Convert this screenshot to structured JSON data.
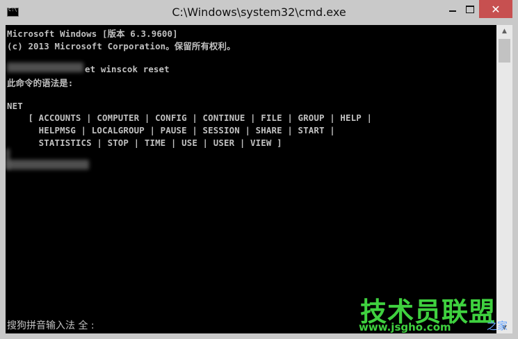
{
  "window": {
    "title": "C:\\Windows\\system32\\cmd.exe",
    "icon_text": "C:\\",
    "controls": {
      "minimize": "—",
      "maximize": "□",
      "close": "✕"
    }
  },
  "console": {
    "lines": [
      "Microsoft Windows [版本 6.3.9600]",
      "(c) 2013 Microsoft Corporation。保留所有权利。",
      "et winscok reset",
      "此命令的语法是:",
      "NET",
      "    [ ACCOUNTS | COMPUTER | CONFIG | CONTINUE | FILE | GROUP | HELP |",
      "      HELPMSG | LOCALGROUP | PAUSE | SESSION | SHARE | START |",
      "      STATISTICS | STOP | TIME | USE | USER | VIEW ]"
    ]
  },
  "ime_status": "搜狗拼音输入法 全 :",
  "watermark": {
    "main": "技术员联盟",
    "url": "www.jsgho.com",
    "tail": "之家"
  },
  "colors": {
    "console_bg": "#000000",
    "console_text": "#c0c0c0",
    "close_button": "#c75050",
    "watermark_green": "#3fd13f"
  }
}
